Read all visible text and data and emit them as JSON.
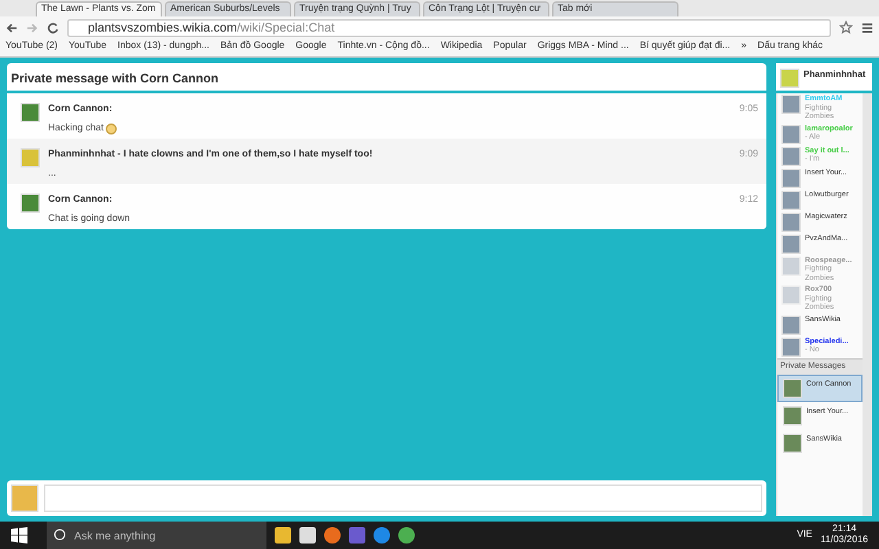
{
  "tabs": [
    {
      "label": "The Lawn - Plants vs. Zom",
      "selected": true
    },
    {
      "label": "American Suburbs/Levels",
      "selected": false
    },
    {
      "label": "Truyện trạng Quỳnh | Truy",
      "selected": false
    },
    {
      "label": "Côn Trạng Lột | Truyện cư",
      "selected": false
    },
    {
      "label": "Tab mới",
      "selected": false
    }
  ],
  "address": {
    "host": "plantsvszombies.wikia.com",
    "path": "/wiki/Special:Chat"
  },
  "bookmarks": [
    "YouTube (2)",
    "YouTube",
    "Inbox (13) - dungph...",
    "Bản đồ Google",
    "Google",
    "Tinhte.vn - Cộng đồ...",
    "Wikipedia",
    "Popular",
    "Griggs MBA - Mind ...",
    "Bí quyết giúp đạt đi...",
    "»",
    "Dấu trang khác"
  ],
  "chat": {
    "title": "Private message with Corn Cannon",
    "messages": [
      {
        "author": "Corn Cannon:",
        "text": "Hacking chat",
        "time": "9:05",
        "emoji": true,
        "highlighted": false
      },
      {
        "author": "Phanminhnhat - I hate clowns and I'm one of them,so I hate myself too!",
        "text": "...",
        "time": "9:09",
        "emoji": false,
        "highlighted": true
      },
      {
        "author": "Corn Cannon:",
        "text": "Chat is going down",
        "time": "9:12",
        "emoji": false,
        "highlighted": false
      }
    ]
  },
  "sidebar": {
    "me": "Phanminhnhat",
    "users": [
      {
        "name": "EmmtoAM",
        "status": "Fighting Zombies",
        "color": "#33ccee",
        "away": false
      },
      {
        "name": "lamaropoalor",
        "status": "- Ale",
        "color": "#44cc44",
        "away": false
      },
      {
        "name": "Say it out l...",
        "status": "- I'm",
        "color": "#44cc44",
        "away": false
      },
      {
        "name": "Insert Your...",
        "color": "#333333",
        "away": false
      },
      {
        "name": "Lolwutburger",
        "color": "#333333",
        "away": false
      },
      {
        "name": "Magicwaterz",
        "color": "#333333",
        "away": false
      },
      {
        "name": "PvzAndMa...",
        "color": "#333333",
        "away": false
      },
      {
        "name": "Roospeage...",
        "status": "Fighting Zombies",
        "color": "#999999",
        "away": true
      },
      {
        "name": "Rox700",
        "status": "Fighting Zombies",
        "color": "#999999",
        "away": true
      },
      {
        "name": "SansWikia",
        "color": "#333333",
        "away": false
      },
      {
        "name": "Specialedi...",
        "status": "- No",
        "color": "#2233ee",
        "away": false
      }
    ],
    "private_header": "Private Messages",
    "private": [
      {
        "name": "Corn Cannon",
        "selected": true
      },
      {
        "name": "Insert Your...",
        "selected": false
      },
      {
        "name": "SansWikia",
        "selected": false
      }
    ]
  },
  "taskbar": {
    "search_placeholder": "Ask me anything",
    "language": "VIE",
    "time": "21:14",
    "date": "11/03/2016"
  }
}
